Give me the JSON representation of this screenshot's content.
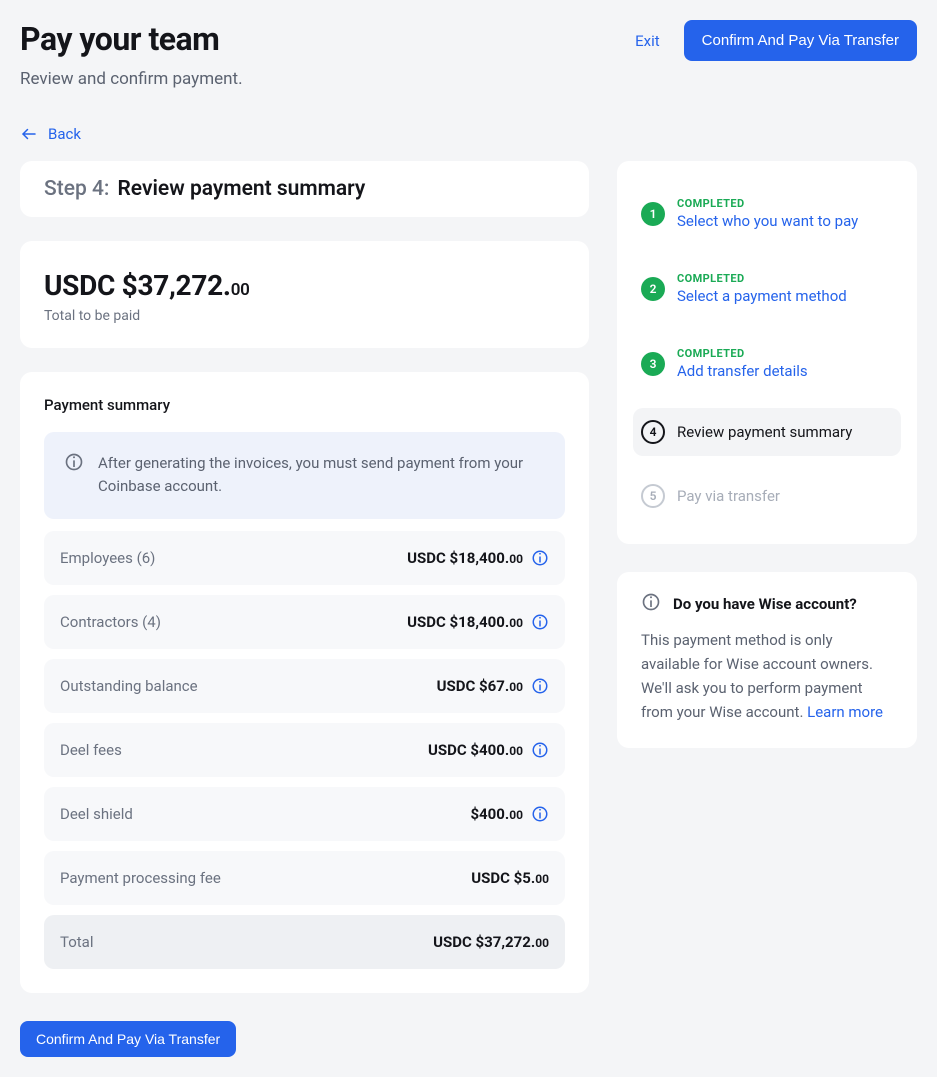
{
  "header": {
    "title": "Pay your team",
    "subtitle": "Review and confirm payment.",
    "exit_label": "Exit",
    "confirm_label": "Confirm And Pay Via Transfer"
  },
  "back": {
    "label": "Back"
  },
  "step_header": {
    "prefix": "Step 4:",
    "label": "Review payment summary"
  },
  "total": {
    "amount_main": "USDC $37,272.",
    "amount_cents": "00",
    "sub": "Total to be paid"
  },
  "summary": {
    "heading": "Payment summary",
    "banner": "After generating the invoices, you must send payment from your Coinbase account.",
    "rows": [
      {
        "label": "Employees (6)",
        "value_main": "USDC $18,400.",
        "value_cents": "00",
        "info": true
      },
      {
        "label": "Contractors (4)",
        "value_main": "USDC $18,400.",
        "value_cents": "00",
        "info": true
      },
      {
        "label": "Outstanding balance",
        "value_main": "USDC $67.",
        "value_cents": "00",
        "info": true
      },
      {
        "label": "Deel fees",
        "value_main": "USDC $400.",
        "value_cents": "00",
        "info": true
      },
      {
        "label": "Deel shield",
        "value_main": "$400.",
        "value_cents": "00",
        "info": true
      },
      {
        "label": "Payment processing fee",
        "value_main": "USDC $5.",
        "value_cents": "00",
        "info": false
      },
      {
        "label": "Total",
        "value_main": "USDC $37,272.",
        "value_cents": "00",
        "info": false,
        "total": true
      }
    ]
  },
  "steps": [
    {
      "num": "1",
      "status": "COMPLETED",
      "label": "Select who you want to pay",
      "state": "done"
    },
    {
      "num": "2",
      "status": "COMPLETED",
      "label": "Select a payment method",
      "state": "done"
    },
    {
      "num": "3",
      "status": "COMPLETED",
      "label": "Add transfer details",
      "state": "done"
    },
    {
      "num": "4",
      "status": "",
      "label": "Review payment summary",
      "state": "current"
    },
    {
      "num": "5",
      "status": "",
      "label": "Pay via transfer",
      "state": "pending"
    }
  ],
  "wise": {
    "title": "Do you have Wise account?",
    "body": "This payment method is only available for Wise account owners. We'll ask you to perform payment from your Wise account. ",
    "link": "Learn more"
  },
  "bottom": {
    "confirm_label": "Confirm And Pay Via Transfer"
  }
}
